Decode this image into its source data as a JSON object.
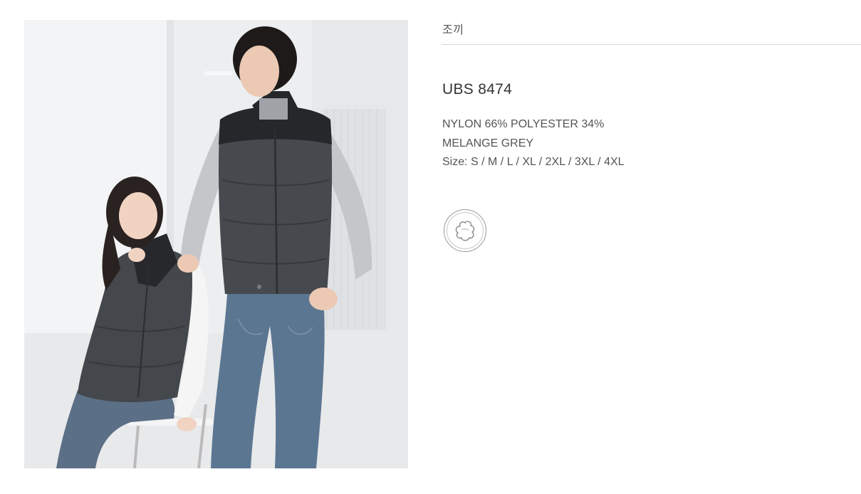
{
  "breadcrumb": {
    "category": "조끼"
  },
  "product": {
    "code": "UBS 8474",
    "material": "NYLON 66% POLYESTER 34%",
    "color": "MELANGE GREY",
    "sizes": "Size: S / M / L / XL / 2XL / 3XL / 4XL",
    "fabric_icon": "cotton-icon"
  },
  "colors": {
    "vest_body": "#46494e",
    "vest_yoke": "#25272b",
    "jeans": "#5b7691",
    "background": "#eef0f1"
  }
}
